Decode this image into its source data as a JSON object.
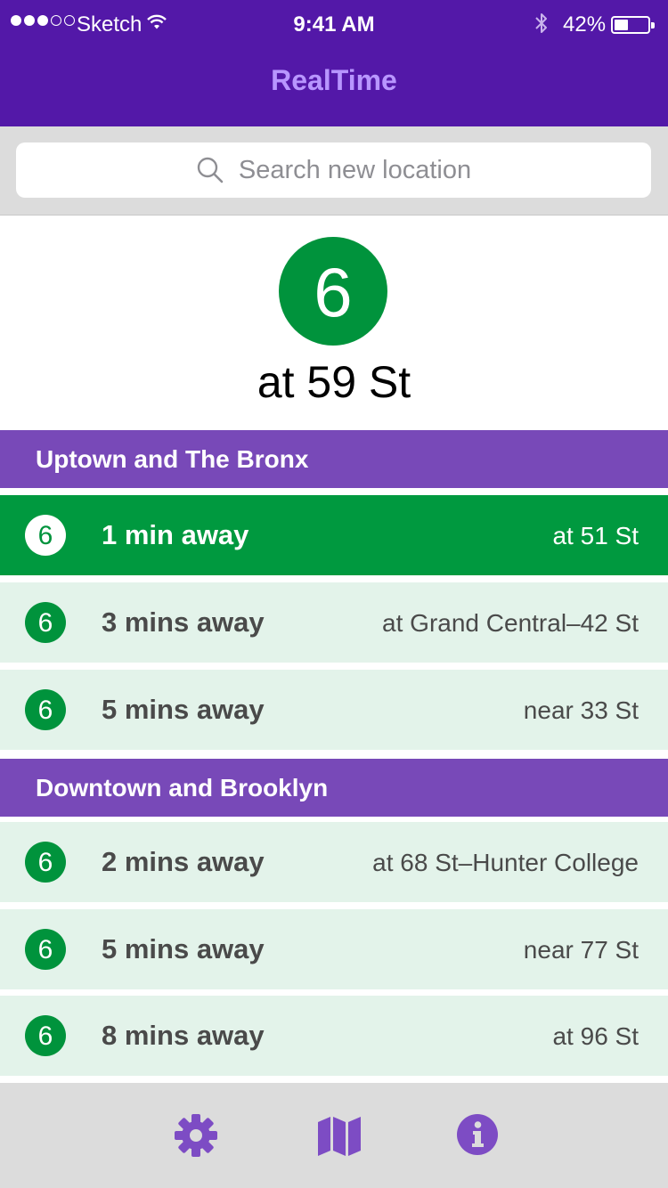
{
  "status_bar": {
    "carrier": "Sketch",
    "time": "9:41 AM",
    "battery_percent_text": "42%",
    "battery_level": 0.42,
    "signal_bars_filled": 3,
    "signal_bars_total": 5
  },
  "nav": {
    "title": "RealTime"
  },
  "search": {
    "placeholder": "Search new location",
    "icon": "search-icon"
  },
  "station": {
    "line": "6",
    "name": "at 59 St",
    "line_color": "#00933c"
  },
  "sections": [
    {
      "title": "Uptown and The Bronx",
      "rows": [
        {
          "line": "6",
          "away": "1 min away",
          "location": "at 51 St",
          "highlighted": true
        },
        {
          "line": "6",
          "away": "3 mins away",
          "location": "at Grand Central–42 St",
          "highlighted": false
        },
        {
          "line": "6",
          "away": "5 mins away",
          "location": "near 33 St",
          "highlighted": false
        }
      ]
    },
    {
      "title": "Downtown and Brooklyn",
      "rows": [
        {
          "line": "6",
          "away": "2 mins away",
          "location": "at 68 St–Hunter College",
          "highlighted": false
        },
        {
          "line": "6",
          "away": "5 mins away",
          "location": "near 77 St",
          "highlighted": false
        },
        {
          "line": "6",
          "away": "8 mins away",
          "location": "at 96 St",
          "highlighted": false
        }
      ]
    }
  ],
  "tabbar": {
    "items": [
      {
        "icon": "gear-icon"
      },
      {
        "icon": "map-icon"
      },
      {
        "icon": "info-icon"
      }
    ]
  },
  "colors": {
    "nav_bg": "#5318a8",
    "nav_title": "#b896ff",
    "section_header": "#7849b8",
    "line_green": "#00933c",
    "row_highlight": "#00993f",
    "row_bg": "#e3f3ea",
    "tab_icon": "#7d4cc4"
  }
}
